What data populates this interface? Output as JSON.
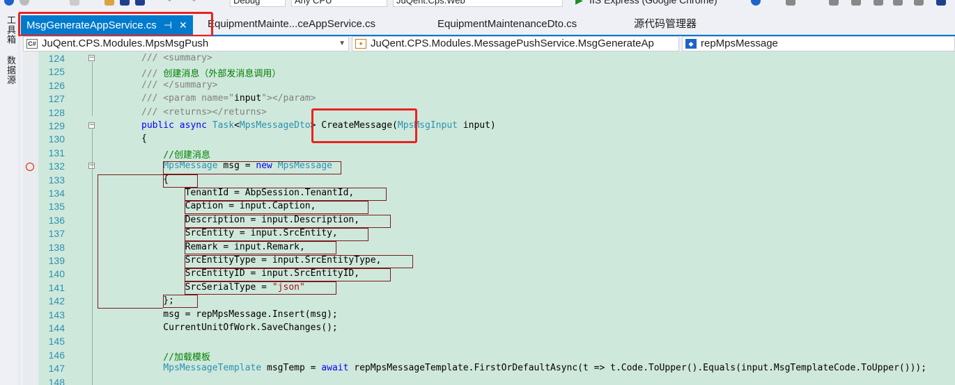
{
  "toolbar": {
    "config": "Debug",
    "platform": "Any CPU",
    "startup": "JuQent.Cps.Web",
    "run_label": "IIS Express (Google Chrome)"
  },
  "side_tabs": [
    "工具箱",
    "数据源"
  ],
  "tabs": [
    {
      "label": "MsgGenerateAppService.cs",
      "active": true
    },
    {
      "label": "EquipmentMainte...ceAppService.cs",
      "active": false
    },
    {
      "label": "EquipmentMaintenanceDto.cs",
      "active": false
    },
    {
      "label": "源代码管理器",
      "active": false
    }
  ],
  "nav": {
    "project": "JuQent.CPS.Modules.MpsMsgPush",
    "class": "JuQent.CPS.Modules.MessagePushService.MsgGenerateAp",
    "member": "repMpsMessage"
  },
  "lines": [
    {
      "n": "124",
      "fold": "⊟",
      "tokens": [
        [
          "c-gray",
          "/// <summary>"
        ]
      ]
    },
    {
      "n": "125",
      "tokens": [
        [
          "c-gray",
          "/// "
        ],
        [
          "c-comment",
          "创建消息（外部发消息调用）"
        ]
      ]
    },
    {
      "n": "126",
      "tokens": [
        [
          "c-gray",
          "/// </summary>"
        ]
      ]
    },
    {
      "n": "127",
      "tokens": [
        [
          "c-gray",
          "/// <param name=\""
        ],
        [
          "c-plain",
          "input"
        ],
        [
          "c-gray",
          "\"></param>"
        ]
      ]
    },
    {
      "n": "128",
      "tokens": [
        [
          "c-gray",
          "/// <returns></returns>"
        ]
      ]
    },
    {
      "n": "129",
      "fold": "⊟",
      "tokens": [
        [
          "c-kw",
          "public async "
        ],
        [
          "c-type",
          "Task"
        ],
        [
          "c-plain",
          "<"
        ],
        [
          "c-type",
          "MpsMessageDto"
        ],
        [
          "c-plain",
          "> CreateMessage("
        ],
        [
          "c-type",
          "MpsMsgInput"
        ],
        [
          "c-plain",
          " input)"
        ]
      ]
    },
    {
      "n": "130",
      "tokens": [
        [
          "c-plain",
          "{"
        ]
      ]
    },
    {
      "n": "131",
      "tokens": [
        [
          "c-plain",
          "    "
        ],
        [
          "c-comment",
          "//创建消息"
        ]
      ]
    },
    {
      "n": "132",
      "fold": "⊟",
      "brk": true,
      "tokens": [
        [
          "c-plain",
          "    "
        ],
        [
          "c-type",
          "MpsMessage"
        ],
        [
          "c-plain",
          " msg = "
        ],
        [
          "c-kw",
          "new "
        ],
        [
          "c-type",
          "MpsMessage"
        ]
      ]
    },
    {
      "n": "133",
      "tokens": [
        [
          "c-plain",
          "    {"
        ]
      ]
    },
    {
      "n": "134",
      "tokens": [
        [
          "c-plain",
          "        TenantId = AbpSession.TenantId,"
        ]
      ]
    },
    {
      "n": "135",
      "tokens": [
        [
          "c-plain",
          "        Caption = input.Caption,"
        ]
      ]
    },
    {
      "n": "136",
      "tokens": [
        [
          "c-plain",
          "        Description = input.Description,"
        ]
      ]
    },
    {
      "n": "137",
      "tokens": [
        [
          "c-plain",
          "        SrcEntity = input.SrcEntity,"
        ]
      ]
    },
    {
      "n": "138",
      "tokens": [
        [
          "c-plain",
          "        Remark = input.Remark,"
        ]
      ]
    },
    {
      "n": "139",
      "tokens": [
        [
          "c-plain",
          "        SrcEntityType = input.SrcEntityType,"
        ]
      ]
    },
    {
      "n": "140",
      "tokens": [
        [
          "c-plain",
          "        SrcEntityID = input.SrcEntityID,"
        ]
      ]
    },
    {
      "n": "141",
      "tokens": [
        [
          "c-plain",
          "        SrcSerialType = "
        ],
        [
          "c-str",
          "\"json\""
        ]
      ]
    },
    {
      "n": "142",
      "tokens": [
        [
          "c-plain",
          "    };"
        ]
      ]
    },
    {
      "n": "143",
      "tokens": [
        [
          "c-plain",
          "    msg = repMpsMessage.Insert(msg);"
        ]
      ]
    },
    {
      "n": "144",
      "tokens": [
        [
          "c-plain",
          "    CurrentUnitOfWork.SaveChanges();"
        ]
      ]
    },
    {
      "n": "145",
      "tokens": []
    },
    {
      "n": "146",
      "tokens": [
        [
          "c-plain",
          "    "
        ],
        [
          "c-comment",
          "//加载模板"
        ]
      ]
    },
    {
      "n": "147",
      "tokens": [
        [
          "c-plain",
          "    "
        ],
        [
          "c-type",
          "MpsMessageTemplate"
        ],
        [
          "c-plain",
          " msgTemp = "
        ],
        [
          "c-kw",
          "await "
        ],
        [
          "c-plain",
          "repMpsMessageTemplate.FirstOrDefaultAsync(t => t.Code.ToUpper().Equals(input.MsgTemplateCode.ToUpper()));"
        ]
      ]
    },
    {
      "n": "148",
      "tokens": []
    }
  ]
}
